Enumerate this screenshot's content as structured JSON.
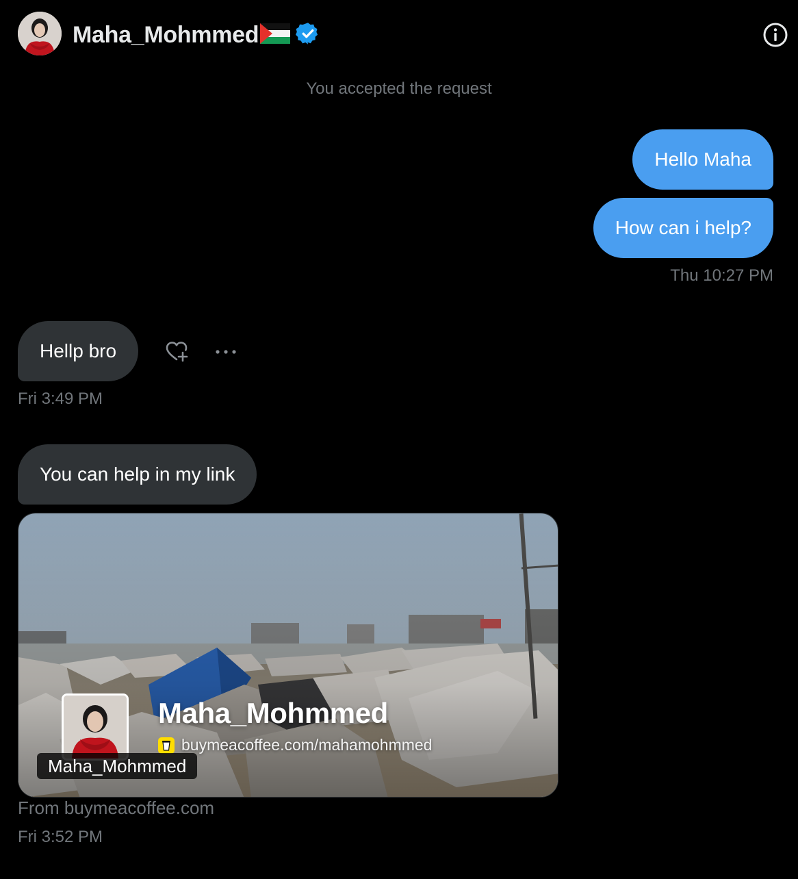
{
  "header": {
    "display_name": "Maha_Mohmmed",
    "flag_icon": "palestine-flag-icon",
    "verified_icon": "verified-badge-icon",
    "info_icon": "info-icon"
  },
  "conversation": {
    "system_note": "You accepted the request",
    "messages": [
      {
        "direction": "sent",
        "text": "Hello Maha"
      },
      {
        "direction": "sent",
        "text": "How can i help?",
        "timestamp": "Thu 10:27 PM"
      },
      {
        "direction": "received",
        "text": "Hellp bro",
        "timestamp": "Fri 3:49 PM"
      },
      {
        "direction": "received",
        "text": "You can help in my link"
      }
    ],
    "link_card": {
      "title": "Maha_Mohmmed",
      "url": "buymeacoffee.com/mahamohmmed",
      "label": "Maha_Mohmmed",
      "source": "From buymeacoffee.com",
      "timestamp": "Fri 3:52 PM"
    }
  },
  "icons": {
    "react": "heart-plus-icon",
    "more": "more-dots-icon"
  },
  "colors": {
    "background": "#000000",
    "sent_bubble": "#4a9ef0",
    "received_bubble": "#2f3336",
    "muted_text": "#71767b",
    "verified_blue": "#1d9bf0"
  }
}
